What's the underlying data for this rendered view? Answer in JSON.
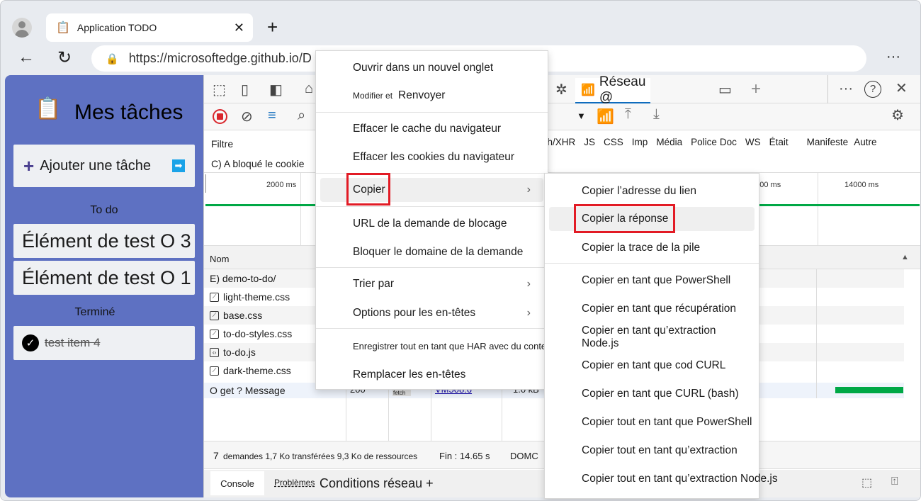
{
  "browser": {
    "tab_title": "Application TODO",
    "url": "https://microsoftedge.github.io/D",
    "icons": [
      "profile-icon",
      "clipboard-icon",
      "close-icon",
      "new-tab-icon",
      "back-icon",
      "refresh-icon",
      "lock-icon",
      "more-icon"
    ]
  },
  "app": {
    "title": "Mes tâches",
    "add_task": "Ajouter une tâche",
    "todo_heading": "To do",
    "todo_items": [
      "Élément de test O 3",
      "Élément de test O 1"
    ],
    "done_heading": "Terminé",
    "done_items": [
      "test item 4"
    ]
  },
  "devtools": {
    "active_tab": "Réseau @",
    "filter_label": "Filtre",
    "blocked_cookie": "C) A bloqué le cookie",
    "filter_types": [
      "tch/XHR",
      "JS",
      "CSS",
      "Imp",
      "Média",
      "Police",
      "Doc",
      "WS",
      "Était",
      "Manifeste",
      "Autre"
    ],
    "timeline_ticks": [
      "2000 ms",
      "2000 ms",
      "14000 ms"
    ],
    "column_name": "Nom",
    "rows": [
      {
        "name": "E) demo-to-do/",
        "icon": "document"
      },
      {
        "name": "light-theme.css",
        "icon": "css"
      },
      {
        "name": "base.css",
        "icon": "css"
      },
      {
        "name": "to-do-styles.css",
        "icon": "css"
      },
      {
        "name": "to-do.js",
        "icon": "js"
      },
      {
        "name": "dark-theme.css",
        "icon": "css"
      },
      {
        "name": "O get ? Message",
        "icon": "fetch",
        "status": "200",
        "type": "fetch",
        "initiator": "VM508:6",
        "size": "1.0 kB"
      }
    ],
    "status": {
      "requests": "7",
      "summary": "demandes 1,7 Ko transférées 9,3 Ko de ressources",
      "finish": "Fin : 14.65 s",
      "domc": "DOMC"
    },
    "drawer_tabs": [
      "Console",
      "Problèmes",
      "Conditions réseau +"
    ]
  },
  "context_menu": {
    "items": [
      "Ouvrir dans un nouvel onglet",
      "Modifier et",
      "Renvoyer",
      "Effacer le cache du navigateur",
      "Effacer les cookies du navigateur",
      "Copier",
      "URL de la demande de blocage",
      "Bloquer le domaine de la demande",
      "Trier par",
      "Options pour les en-têtes",
      "Enregistrer tout en tant que HAR avec du contenu",
      "Remplacer les en-têtes"
    ]
  },
  "submenu": {
    "items": [
      "Copier l’adresse du lien",
      "Copier la réponse",
      "Copier la trace de la pile",
      "Copier en tant que PowerShell",
      "Copier en tant que récupération",
      "Copier en tant qu’extraction Node.js",
      "Copier en tant que cod CURL",
      "Copier en tant que CURL (bash)",
      "Copier tout en tant que PowerShell",
      "Copier tout en tant qu’extraction",
      "Copier tout en tant qu’extraction Node.js"
    ]
  },
  "colors": {
    "app_bg": "#5e71c2",
    "highlight": "#e21b25",
    "accent": "#0f6cbd",
    "waterfall": "#00a846"
  }
}
